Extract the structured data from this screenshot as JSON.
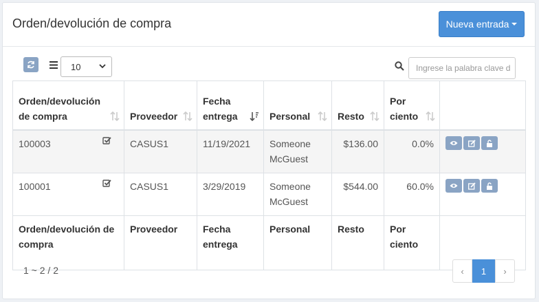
{
  "header": {
    "title": "Orden/devolución de compra",
    "new_button_label": "Nueva entrada"
  },
  "toolbar": {
    "page_size": "10",
    "search_placeholder": "Ingrese la palabra clave d"
  },
  "table": {
    "columns": [
      "Orden/devolución de compra",
      "Proveedor",
      "Fecha entrega",
      "Personal",
      "Resto",
      "Por ciento"
    ],
    "footer_columns": [
      "Orden/devolución de compra",
      "Proveedor",
      "Fecha entrega",
      "Personal",
      "Resto",
      "Por ciento"
    ],
    "rows": [
      {
        "id": "100003",
        "supplier": "CASUS1",
        "date": "11/19/2021",
        "staff": "Someone McGuest",
        "rest": "$136.00",
        "percent": "0.0%"
      },
      {
        "id": "100001",
        "supplier": "CASUS1",
        "date": "3/29/2019",
        "staff": "Someone McGuest",
        "rest": "$544.00",
        "percent": "60.0%"
      }
    ]
  },
  "footer": {
    "summary": "1 ~ 2 / 2",
    "pager": {
      "prev": "‹",
      "current": "1",
      "next": "›"
    }
  },
  "colors": {
    "primary": "#4a90d9",
    "icon_button": "#8aa4c4"
  }
}
